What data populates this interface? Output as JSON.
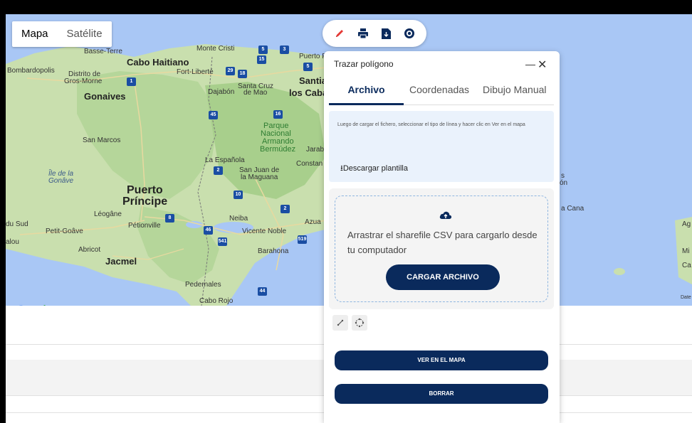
{
  "map": {
    "type_control": {
      "map_label": "Mapa",
      "satellite_label": "Satélite"
    },
    "labels": {
      "basse_terre": "Basse-Terre",
      "monte_cristi": "Monte Cristi",
      "puerto_plata": "Puerto P",
      "bombardopolis": "Bombardopolis",
      "cabo_haitiano": "Cabo Haitiano",
      "fort_liberte": "Fort-Liberté",
      "distrito_de": "Distrito de",
      "gros_morne": "Gros-Morne",
      "gonaives": "Gonaives",
      "dajabon": "Dajabón",
      "santa_cruz": "Santa Cruz",
      "de_mao": "de Mao",
      "santiago": "Santiag",
      "los_cabal": "los Caba",
      "parque_1": "Parque",
      "parque_2": "Nacional",
      "parque_3": "Armando",
      "parque_4": "Bermúdez",
      "jarab": "Jarab",
      "san_marcos": "San Marcos",
      "la_espanola": "La Española",
      "constanza": "Constan",
      "san_juan_1": "San Juan de",
      "san_juan_2": "la Maguana",
      "ile_de_la": "Île de la",
      "gonave": "Gonâve",
      "puerto_principe_1": "Puerto",
      "puerto_principe_2": "Príncipe",
      "leogane": "Léogâne",
      "petionville": "Pétionville",
      "du_sud": "du Sud",
      "petit_goave": "Petit-Goâve",
      "neiba": "Neiba",
      "azua": "Azua",
      "vicente_noble": "Vicente Noble",
      "alou": "alou",
      "abricot": "Abricot",
      "jacmel": "Jacmel",
      "barahona": "Barahona",
      "pedernales": "Pedernales",
      "cabo_rojo": "Cabo Rojo",
      "right_s": "s",
      "right_on": "ón",
      "right_cana": "a Cana",
      "right_ag": "Ag",
      "right_mi": "Mi",
      "right_ca": "Ca",
      "right_date": "Date"
    },
    "shields": [
      "5",
      "3",
      "15",
      "1",
      "29",
      "18",
      "5",
      "45",
      "16",
      "2",
      "10",
      "2",
      "8",
      "46",
      "541",
      "519",
      "44"
    ],
    "google_logo": [
      "G",
      "o",
      "o",
      "g",
      "l",
      "e"
    ]
  },
  "toolbar": {
    "icons": [
      "pencil-icon",
      "print-icon",
      "save-file-icon",
      "target-icon"
    ],
    "colors": {
      "pencil": "#e53935",
      "icons": "#0a2a5c"
    }
  },
  "panel": {
    "title": "Trazar polígono",
    "minimize": "—",
    "close": "✕",
    "tabs": [
      "Archivo",
      "Coordenadas",
      "Dibujo Manual"
    ],
    "info_text": "Luego de cargar el fichero, seleccionar el tipo de línea y hacer clic en Ver en el mapa",
    "download_link": "⭳Descargar plantilla",
    "upload_text": "Arrastrar el sharefile CSV para cargarlo desde tu computador",
    "upload_button": "CARGAR ARCHIVO",
    "view_button": "VER EN EL MAPA",
    "clear_button": "BORRAR",
    "accent_color": "#0a2a5c"
  }
}
